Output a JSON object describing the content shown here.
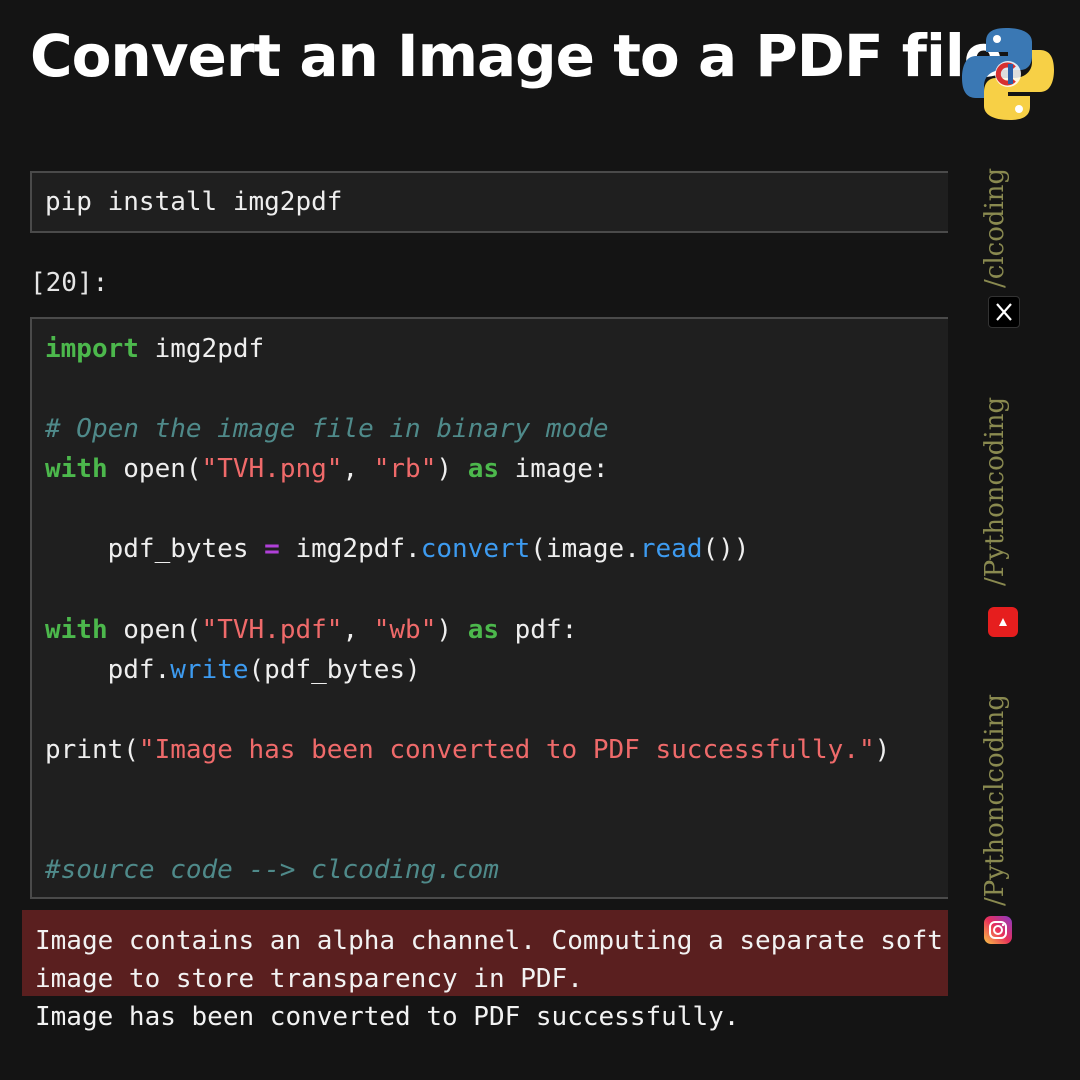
{
  "title": "Convert an Image to a PDF file",
  "cell1": {
    "code": "pip install img2pdf"
  },
  "cell2": {
    "prompt": "[20]:",
    "lines": [
      [
        {
          "t": "import",
          "c": "kw"
        },
        {
          "t": " img2pdf",
          "c": "pl"
        }
      ],
      [],
      [
        {
          "t": "# Open the image file in binary mode",
          "c": "cm"
        }
      ],
      [
        {
          "t": "with",
          "c": "kw"
        },
        {
          "t": " open(",
          "c": "pl"
        },
        {
          "t": "\"TVH.png\"",
          "c": "str"
        },
        {
          "t": ", ",
          "c": "pl"
        },
        {
          "t": "\"rb\"",
          "c": "str"
        },
        {
          "t": ") ",
          "c": "pl"
        },
        {
          "t": "as",
          "c": "kw"
        },
        {
          "t": " image:",
          "c": "pl"
        }
      ],
      [],
      [
        {
          "t": "    pdf_bytes ",
          "c": "pl"
        },
        {
          "t": "=",
          "c": "op"
        },
        {
          "t": " img2pdf.",
          "c": "pl"
        },
        {
          "t": "convert",
          "c": "fn"
        },
        {
          "t": "(image.",
          "c": "pl"
        },
        {
          "t": "read",
          "c": "fn"
        },
        {
          "t": "())",
          "c": "pl"
        }
      ],
      [],
      [
        {
          "t": "with",
          "c": "kw"
        },
        {
          "t": " open(",
          "c": "pl"
        },
        {
          "t": "\"TVH.pdf\"",
          "c": "str"
        },
        {
          "t": ", ",
          "c": "pl"
        },
        {
          "t": "\"wb\"",
          "c": "str"
        },
        {
          "t": ") ",
          "c": "pl"
        },
        {
          "t": "as",
          "c": "kw"
        },
        {
          "t": " pdf:",
          "c": "pl"
        }
      ],
      [
        {
          "t": "    pdf.",
          "c": "pl"
        },
        {
          "t": "write",
          "c": "fn"
        },
        {
          "t": "(pdf_bytes)",
          "c": "pl"
        }
      ],
      [],
      [
        {
          "t": "print(",
          "c": "pl"
        },
        {
          "t": "\"Image has been converted to PDF successfully.\"",
          "c": "str"
        },
        {
          "t": ")",
          "c": "pl"
        }
      ],
      [],
      [],
      [
        {
          "t": "#source code --> clcoding.com",
          "c": "cm"
        }
      ]
    ]
  },
  "output": {
    "warning": "Image contains an alpha channel. Computing a separate soft\nimage to store transparency in PDF.",
    "result": "Image has been converted to PDF successfully."
  },
  "social": {
    "twitter_handle": "/clcoding",
    "youtube_handle": "/Pythoncoding",
    "instagram_handle": "/Pythonclcoding",
    "icons": [
      "x-icon",
      "youtube-icon",
      "instagram-icon"
    ]
  }
}
